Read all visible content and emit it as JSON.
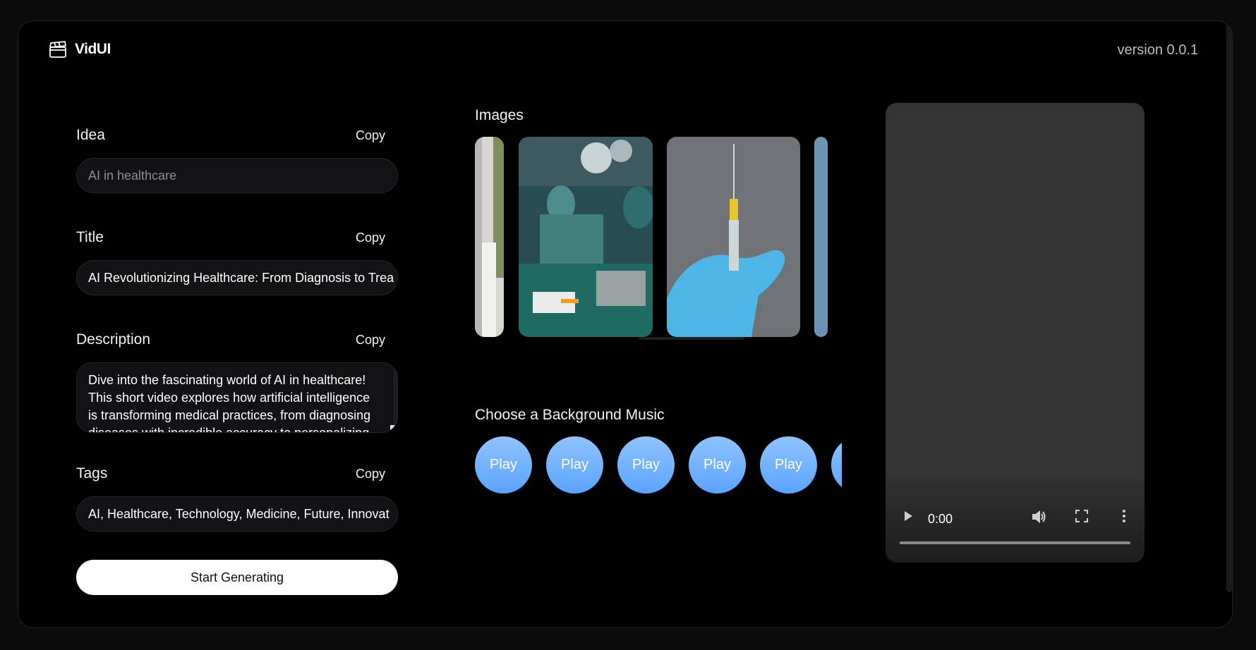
{
  "header": {
    "brand": "VidUI",
    "version": "version 0.0.1",
    "logo_icon": "clapperboard-icon"
  },
  "fields": {
    "idea": {
      "label": "Idea",
      "copy": "Copy",
      "value": "AI in healthcare"
    },
    "title": {
      "label": "Title",
      "copy": "Copy",
      "value": "AI Revolutionizing Healthcare: From Diagnosis to Trea"
    },
    "description": {
      "label": "Description",
      "copy": "Copy",
      "value": "Dive into the fascinating world of AI in healthcare! This short video explores how artificial intelligence is transforming medical practices, from diagnosing diseases with incredible accuracy to personalizing"
    },
    "tags": {
      "label": "Tags",
      "copy": "Copy",
      "value": "AI, Healthcare, Technology, Medicine, Future, Innovat"
    }
  },
  "actions": {
    "start": "Start Generating"
  },
  "images": {
    "title": "Images"
  },
  "music": {
    "title": "Choose a Background Music",
    "play_label": "Play"
  },
  "video": {
    "time": "0:00"
  },
  "colors": {
    "accent": "#5aa4ff",
    "background": "#000000",
    "field": "#121214"
  }
}
